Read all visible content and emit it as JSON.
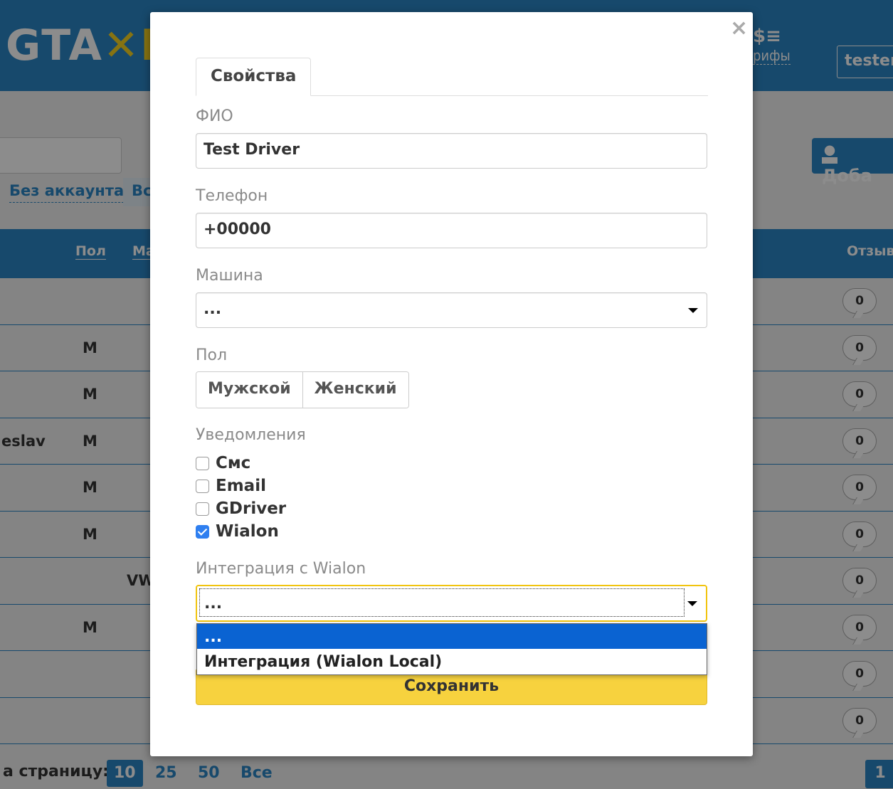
{
  "background": {
    "logo": {
      "text": "GTA",
      "mark": "✕I"
    },
    "header": {
      "tariffs_icon": "$≡",
      "tariffs_label": "рифы",
      "user_label": "tester"
    },
    "filters": {
      "no_account": "Без аккаунта",
      "all": "Вс"
    },
    "add_button_label": "Доба",
    "table": {
      "headers": {
        "gender": "Пол",
        "car": "Ма",
        "reviews": "Отзывы"
      },
      "rows": [
        {
          "name": "",
          "gender": "",
          "car": "",
          "reviews": "0"
        },
        {
          "name": "",
          "gender": "М",
          "car": "",
          "reviews": "0"
        },
        {
          "name": "",
          "gender": "М",
          "car": "",
          "reviews": "0"
        },
        {
          "name": "eslav",
          "gender": "М",
          "car": "",
          "reviews": "0"
        },
        {
          "name": "",
          "gender": "М",
          "car": "",
          "reviews": "0"
        },
        {
          "name": "",
          "gender": "М",
          "car": "",
          "reviews": "0"
        },
        {
          "name": "",
          "gender": "",
          "car": "VW",
          "reviews": "0"
        },
        {
          "name": "",
          "gender": "М",
          "car": "",
          "reviews": "0"
        },
        {
          "name": "",
          "gender": "",
          "car": "",
          "reviews": "0"
        },
        {
          "name": "",
          "gender": "",
          "car": "",
          "reviews": "0"
        }
      ]
    },
    "footer": {
      "per_page_label": "а страницу:",
      "page_sizes": [
        "10",
        "25",
        "50",
        "Все"
      ],
      "active_page_size": "10",
      "current_page": "1"
    }
  },
  "modal": {
    "close_icon": "×",
    "tab_label": "Свойства",
    "fio": {
      "label": "ФИО",
      "value": "Test Driver"
    },
    "phone": {
      "label": "Телефон",
      "value": "+00000"
    },
    "car": {
      "label": "Машина",
      "value": "..."
    },
    "gender": {
      "label": "Пол",
      "options": [
        "Мужской",
        "Женский"
      ]
    },
    "notifications": {
      "label": "Уведомления",
      "items": [
        {
          "label": "Смс",
          "checked": false
        },
        {
          "label": "Email",
          "checked": false
        },
        {
          "label": "GDriver",
          "checked": false
        },
        {
          "label": "Wialon",
          "checked": true
        }
      ]
    },
    "wialon_integration": {
      "label": "Интеграция с Wialon",
      "value": "...",
      "options": [
        "...",
        "Интеграция (Wialon Local)"
      ],
      "selected_index": 0
    },
    "save_label": "Сохранить"
  },
  "colors": {
    "primary": "#2a86c5",
    "save_button": "#f7d23e",
    "focus_border": "#f1c40f",
    "dropdown_selected": "#0a63d2",
    "checkbox_checked": "#2f7ff0"
  }
}
